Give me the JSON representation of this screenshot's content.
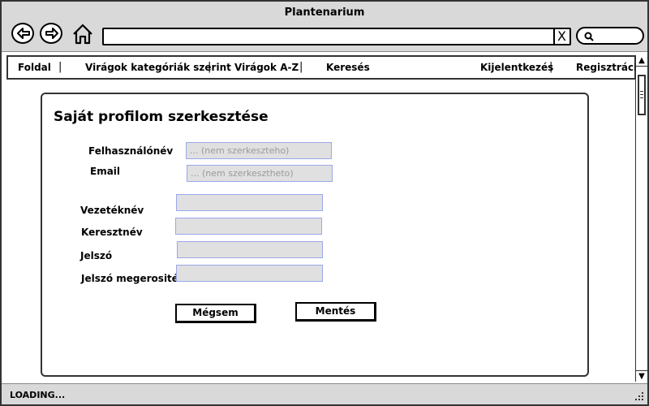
{
  "window": {
    "title": "Plantenarium"
  },
  "toolbar": {
    "back_icon": "back-arrow-icon",
    "forward_icon": "forward-arrow-icon",
    "home_icon": "home-icon",
    "address_value": "",
    "clear_label": "X",
    "search_icon": "search-icon"
  },
  "nav": {
    "items": [
      "Foldal",
      "Virágok kategóriák szerint",
      "Virágok A-Z",
      "Keresés",
      "Kijelentkezés",
      "Regisztráció"
    ],
    "separator": "|"
  },
  "form": {
    "title": "Saját profilom szerkesztése",
    "fields": {
      "username": {
        "label": "Felhasználónév",
        "value": "...  (nem szerkeszteho)"
      },
      "email": {
        "label": "Email",
        "value": "...  (nem szerkesztheto)"
      },
      "lastname": {
        "label": "Vezetéknév",
        "value": ""
      },
      "firstname": {
        "label": "Keresztnév",
        "value": ""
      },
      "password": {
        "label": "Jelszó",
        "value": ""
      },
      "password_confirm": {
        "label": "Jelszó megerositése",
        "value": ""
      }
    },
    "cancel_label": "Mégsem",
    "save_label": "Mentés"
  },
  "status": {
    "text": "LOADING..."
  },
  "colors": {
    "chrome": "#d9d9d9",
    "field_bg": "#e0e0e0",
    "field_border": "#9aa8e8"
  }
}
